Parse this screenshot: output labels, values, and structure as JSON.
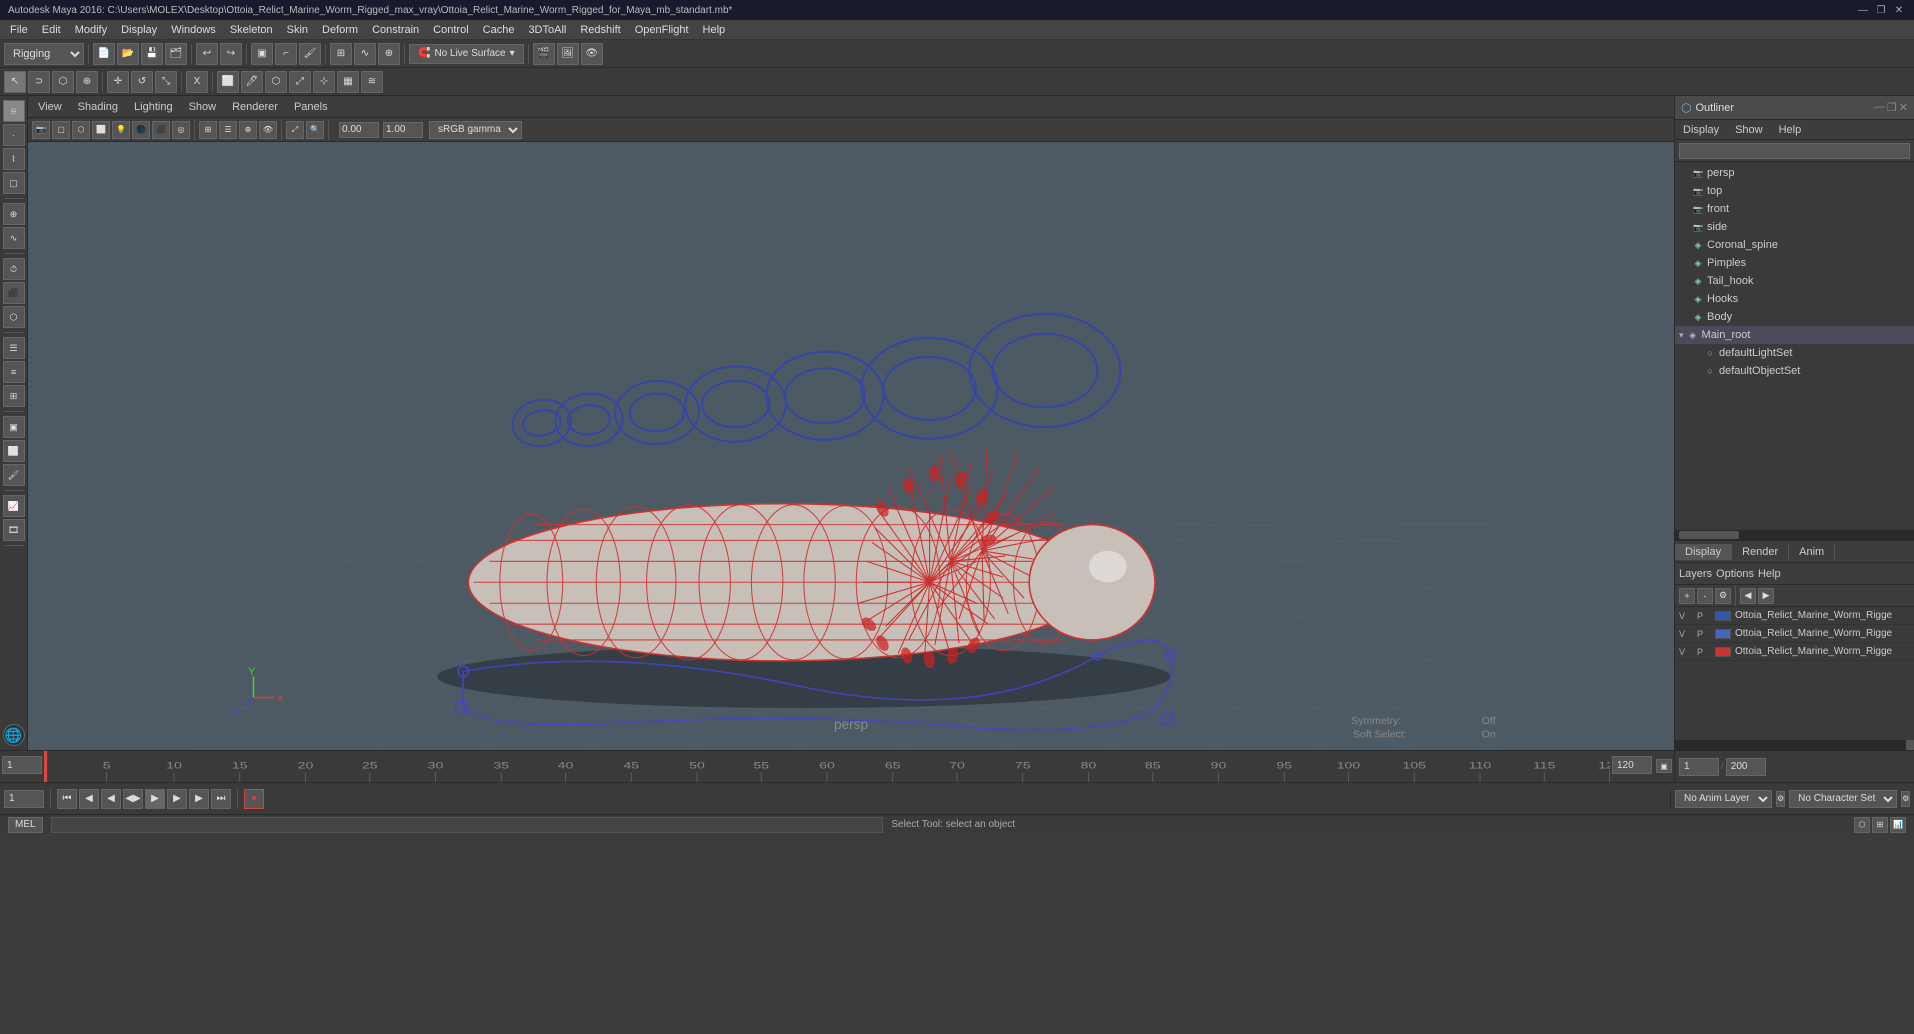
{
  "titlebar": {
    "title": "Autodesk Maya 2016: C:\\Users\\MOLEX\\Desktop\\Ottoia_Relict_Marine_Worm_Rigged_max_vray\\Ottoia_Relict_Marine_Worm_Rigged_for_Maya_mb_standart.mb*",
    "minimize": "—",
    "restore": "❐",
    "close": "✕"
  },
  "menubar": {
    "items": [
      "File",
      "Edit",
      "Modify",
      "Display",
      "Windows",
      "Skeleton",
      "Skin",
      "Deform",
      "Constrain",
      "Control",
      "Cache",
      "3DToAll",
      "Redshift",
      "OpenFlight",
      "Help"
    ]
  },
  "toolbar1": {
    "mode_dropdown": "Rigging",
    "live_surface": "No Live Surface"
  },
  "viewport": {
    "menus": [
      "View",
      "Shading",
      "Lighting",
      "Show",
      "Renderer",
      "Panels"
    ],
    "label": "persp",
    "symmetry_label": "Symmetry:",
    "symmetry_value": "Off",
    "soft_select_label": "Soft Select:",
    "soft_select_value": "On",
    "gamma_label": "sRGB gamma",
    "value1": "0.00",
    "value2": "1.00"
  },
  "outliner": {
    "title": "Outliner",
    "menus": [
      "Display",
      "Show",
      "Help"
    ],
    "search_placeholder": "",
    "tree_items": [
      {
        "id": "persp",
        "label": "persp",
        "type": "cam",
        "indent": 0
      },
      {
        "id": "top",
        "label": "top",
        "type": "cam",
        "indent": 0
      },
      {
        "id": "front",
        "label": "front",
        "type": "cam",
        "indent": 0
      },
      {
        "id": "side",
        "label": "side",
        "type": "cam",
        "indent": 0
      },
      {
        "id": "coronal_spine",
        "label": "Coronal_spine",
        "type": "mesh",
        "indent": 0
      },
      {
        "id": "pimples",
        "label": "Pimples",
        "type": "mesh",
        "indent": 0
      },
      {
        "id": "tail_hook",
        "label": "Tail_hook",
        "type": "mesh",
        "indent": 0
      },
      {
        "id": "hooks",
        "label": "Hooks",
        "type": "mesh",
        "indent": 0
      },
      {
        "id": "body",
        "label": "Body",
        "type": "mesh",
        "indent": 0
      },
      {
        "id": "main_root",
        "label": "Main_root",
        "type": "group",
        "indent": 0,
        "expanded": true
      },
      {
        "id": "defaultLightSet",
        "label": "defaultLightSet",
        "type": "set",
        "indent": 1
      },
      {
        "id": "defaultObjectSet",
        "label": "defaultObjectSet",
        "type": "set",
        "indent": 1
      }
    ]
  },
  "bottom_tabs": {
    "tabs": [
      "Display",
      "Render",
      "Anim"
    ],
    "active": "Display"
  },
  "layer_toolbar": {
    "items": []
  },
  "layers": [
    {
      "v": "V",
      "p": "P",
      "color": "#3355aa",
      "name": "Ottoia_Relict_Marine_Worm_Rigge"
    },
    {
      "v": "V",
      "p": "P",
      "color": "#4466bb",
      "name": "Ottoia_Relict_Marine_Worm_Rigge"
    },
    {
      "v": "V",
      "p": "P",
      "color": "#cc3333",
      "name": "Ottoia_Relict_Marine_Worm_Rigge"
    }
  ],
  "timeline": {
    "start": "1",
    "end_play": "120",
    "start_range": "1",
    "end_range": "200",
    "current_frame": "1",
    "ticks": [
      "1",
      "5",
      "10",
      "15",
      "20",
      "25",
      "30",
      "35",
      "40",
      "45",
      "50",
      "55",
      "60",
      "65",
      "70",
      "75",
      "80",
      "85",
      "90",
      "95",
      "100",
      "105",
      "110",
      "115",
      "120"
    ]
  },
  "transport": {
    "no_anim_layer": "No Anim Layer",
    "no_character_set": "No Character Set",
    "buttons": [
      "⏮",
      "⏭",
      "◀◀",
      "◀",
      "▶",
      "▶▶",
      "⏭"
    ]
  },
  "status_bar": {
    "mode": "MEL",
    "message": "Select Tool: select an object"
  },
  "icons": {
    "camera": "📷",
    "mesh": "▣",
    "group": "▷",
    "set": "○",
    "expand": "▸",
    "collapse": "▾"
  },
  "left_toolbar": {
    "tools": [
      "↖",
      "↕",
      "↺",
      "⊕",
      "⬡",
      "▢",
      "⊞",
      "⚙",
      "☰",
      "≡",
      "⬜",
      "▦"
    ]
  }
}
